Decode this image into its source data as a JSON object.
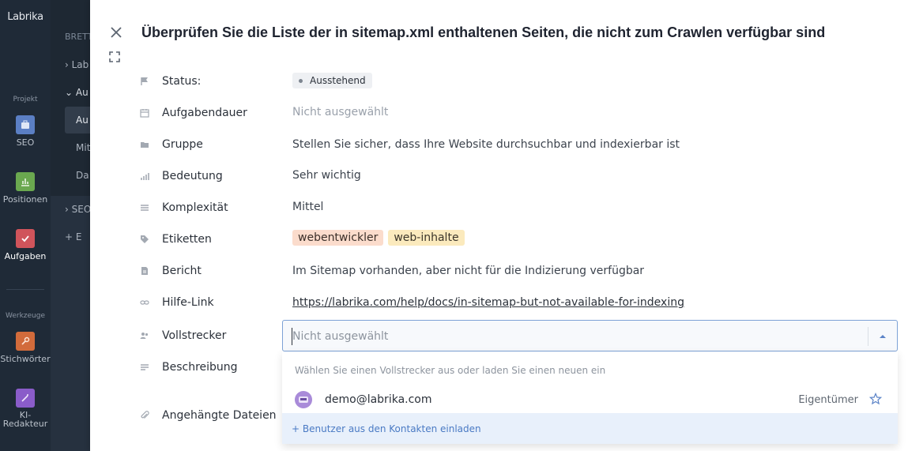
{
  "rail": {
    "logo": "Labrika",
    "section_project": "Projekt",
    "section_tools": "Werkzeuge",
    "items": [
      {
        "label": "SEO",
        "icon": "seo-icon",
        "color": "#5b7fc4"
      },
      {
        "label": "Positionen",
        "icon": "chart-icon",
        "color": "#6aa84f"
      },
      {
        "label": "Aufgaben",
        "icon": "check-icon",
        "color": "#d0545b"
      },
      {
        "label": "Stichwörter",
        "icon": "key-icon",
        "color": "#d26b3b"
      },
      {
        "label": "KI-Redakteur",
        "icon": "magic-wand-icon",
        "color": "#8a5cc9"
      }
    ]
  },
  "subnav": {
    "header": "BRETT",
    "rows": [
      "Lab",
      "Au",
      "Au",
      "Mit",
      "Da",
      "SEO",
      "+ E"
    ]
  },
  "task": {
    "title": "Überprüfen Sie die Liste der in sitemap.xml enthaltenen Seiten, die nicht zum Crawlen verfügbar sind",
    "labels": {
      "status": "Status:",
      "duration": "Aufgabendauer",
      "group": "Gruppe",
      "importance": "Bedeutung",
      "complexity": "Komplexität",
      "tags": "Etiketten",
      "report": "Bericht",
      "help_link": "Hilfe-Link",
      "assignee": "Vollstrecker",
      "description": "Beschreibung",
      "attachments": "Angehängte Dateien"
    },
    "values": {
      "status": "Ausstehend",
      "duration": "Nicht ausgewählt",
      "group": "Stellen Sie sicher, dass Ihre Website durchsuchbar und indexierbar ist",
      "importance": "Sehr wichtig",
      "complexity": "Mittel",
      "tags": [
        "webentwickler",
        "web-inhalte"
      ],
      "report": "Im Sitemap vorhanden, aber nicht für die Indizierung verfügbar",
      "help_link": "https://labrika.com/help/docs/in-sitemap-but-not-available-for-indexing"
    }
  },
  "assignee_select": {
    "placeholder": "Nicht ausgewählt",
    "hint": "Wählen Sie einen Vollstrecker aus oder laden Sie einen neuen ein",
    "users": [
      {
        "email": "demo@labrika.com",
        "role": "Eigentümer"
      }
    ],
    "invite": "+  Benutzer aus den Kontakten einladen"
  },
  "colors": {
    "accent": "#5b83c7",
    "rail_bg": "#1f2a37",
    "tag_dev": "#fbdccc",
    "tag_content": "#fbeabd"
  }
}
